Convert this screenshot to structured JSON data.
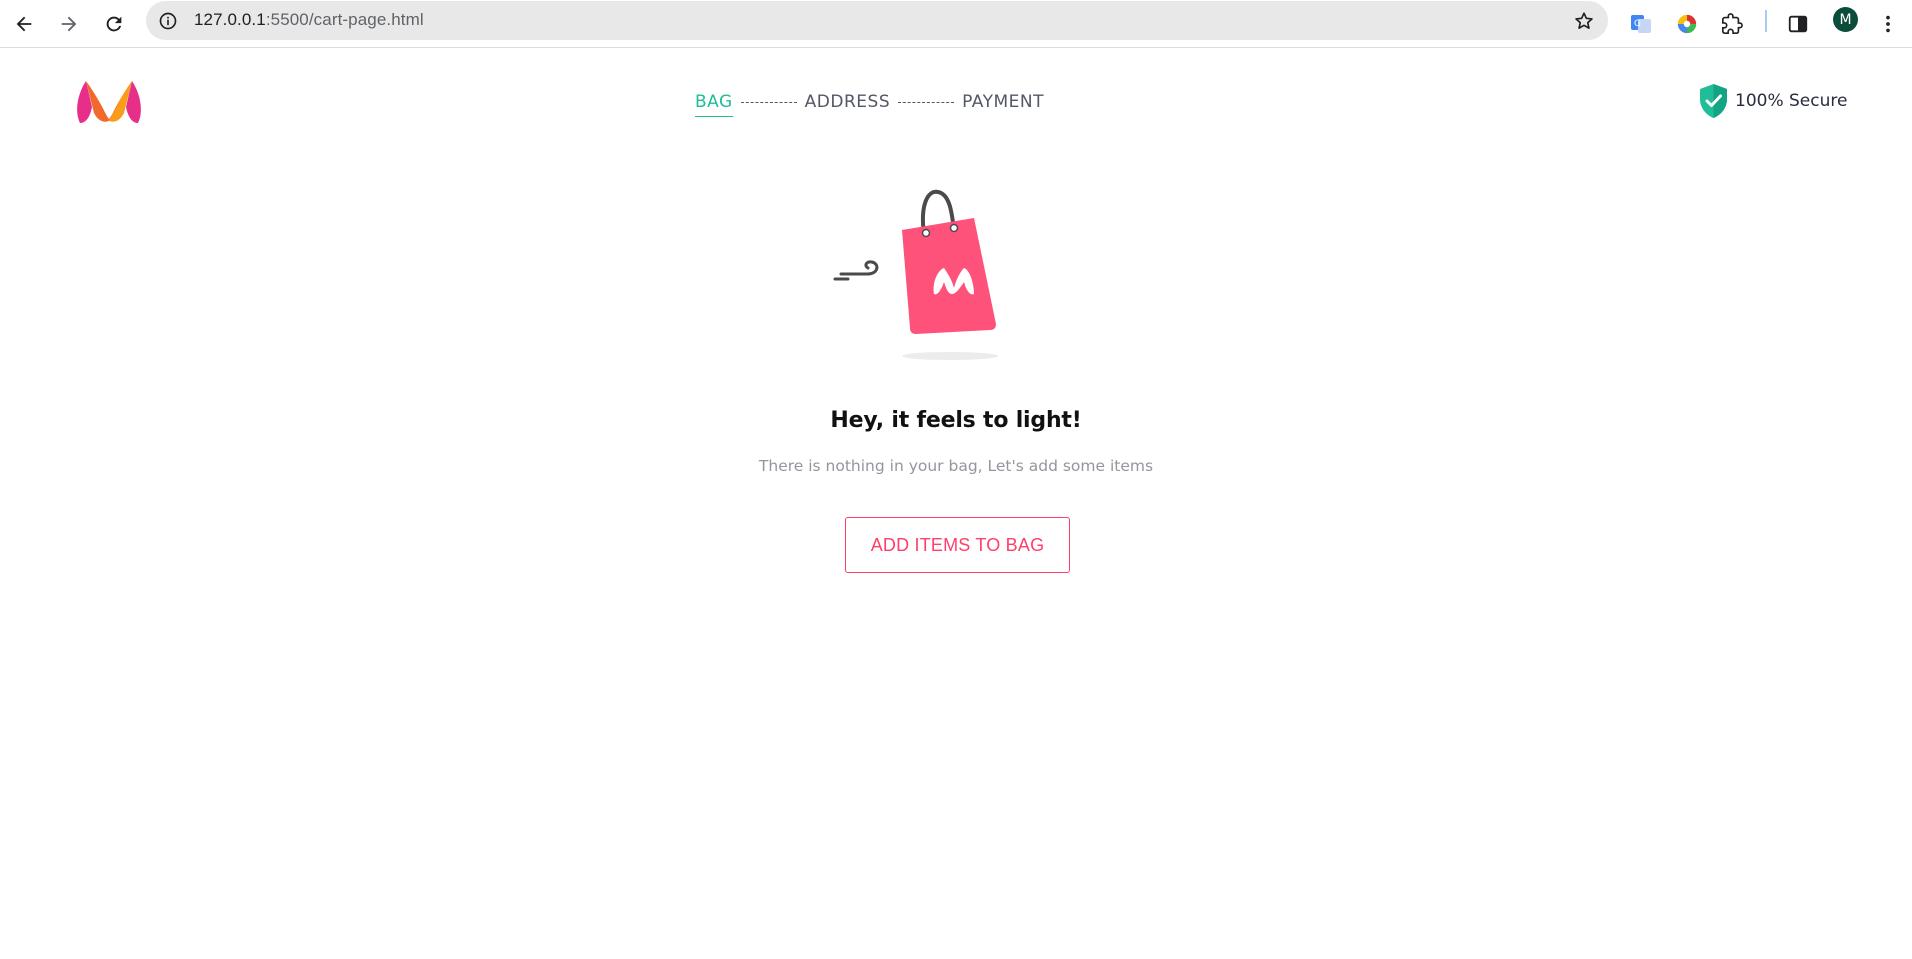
{
  "browser": {
    "url_host": "127.0.0.1",
    "url_path": ":5500/cart-page.html",
    "profile_initial": "M",
    "icons": [
      "back-icon",
      "forward-icon",
      "reload-icon",
      "site-info-icon",
      "bookmark-star-icon",
      "google-translate-icon",
      "color-picker-icon",
      "extensions-puzzle-icon",
      "side-panel-icon",
      "menu-kebab-icon"
    ]
  },
  "header": {
    "logo": "myntra-logo",
    "steps": [
      {
        "label": "BAG",
        "active": true
      },
      {
        "label": "ADDRESS",
        "active": false
      },
      {
        "label": "PAYMENT",
        "active": false
      }
    ],
    "secure_text": "100% Secure"
  },
  "empty_bag": {
    "title": "Hey, it feels to light!",
    "subtitle": "There is nothing in your bag, Let's add some items",
    "button_label": "ADD ITEMS TO BAG"
  },
  "colors": {
    "active_step": "#20bd99",
    "brand_pink": "#ff3f6c",
    "bag_pink": "#ff527b",
    "text_dark": "#282c3f",
    "text_muted": "#94969f"
  }
}
